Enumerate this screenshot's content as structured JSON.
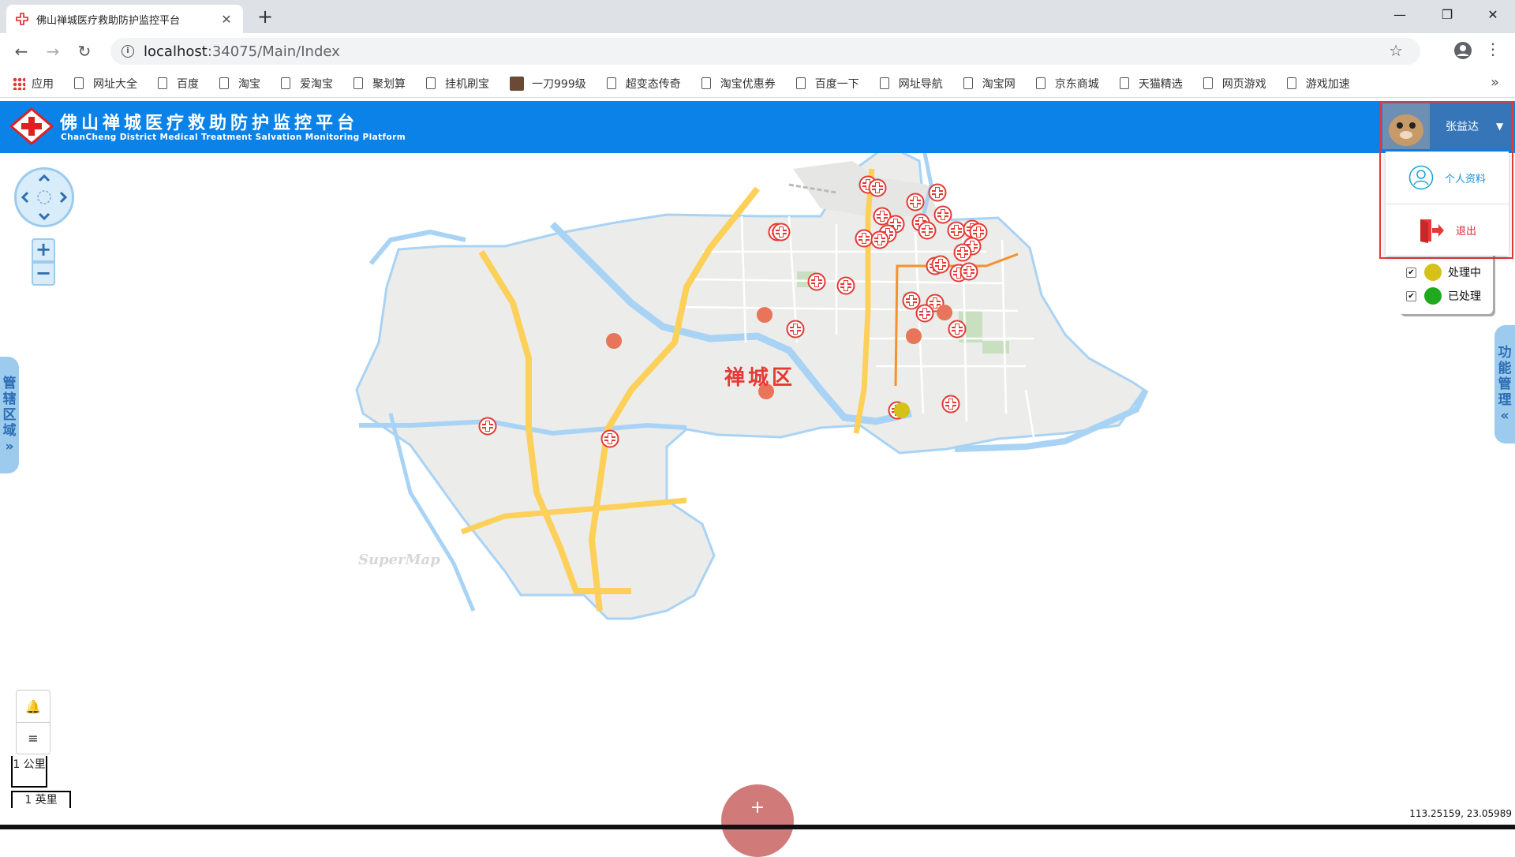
{
  "browser": {
    "tab_title": "佛山禅城医疗救助防护监控平台",
    "tab_close": "✕",
    "new_tab": "+",
    "window_controls": {
      "minimize": "—",
      "maximize": "❐",
      "close": "✕"
    },
    "url_host": "localhost",
    "url_path": ":34075/Main/Index",
    "bookmarks": [
      "应用",
      "网址大全",
      "百度",
      "淘宝",
      "爱淘宝",
      "聚划算",
      "挂机刷宝",
      "一刀999级",
      "超变态传奇",
      "淘宝优惠券",
      "百度一下",
      "网址导航",
      "淘宝网",
      "京东商城",
      "天猫精选",
      "网页游戏",
      "游戏加速"
    ],
    "bookmarks_more": "»"
  },
  "header": {
    "title_cn": "佛山禅城医疗救助防护监控平台",
    "title_en": "ChanCheng District Medical Treatment Salvation Monitoring Platform"
  },
  "user": {
    "name": "张益达",
    "caret": "▼",
    "menu": {
      "profile": "个人资料",
      "logout": "退出"
    }
  },
  "map": {
    "left_tab": [
      "管",
      "辖",
      "区",
      "域",
      "»"
    ],
    "right_tab": [
      "功",
      "能",
      "管",
      "理",
      "«"
    ],
    "district_label": "禅城区",
    "watermark": "SuperMap",
    "zoom_in": "+",
    "zoom_out": "−",
    "legend": [
      {
        "label": "处理中",
        "color": "#d4c21a",
        "checked": "✔"
      },
      {
        "label": "已处理",
        "color": "#22a81e",
        "checked": "✔"
      }
    ],
    "tools": {
      "bell": "🔔",
      "list": "≡"
    },
    "scale_km": "1 公里",
    "scale_mi": "1 英里",
    "fab": "+",
    "coordinates": "113.25159, 23.05989"
  },
  "colors": {
    "header_blue": "#0b82e8",
    "user_bar": "#3575b8",
    "alert_border": "#e53935",
    "incident": "#e8745a"
  }
}
